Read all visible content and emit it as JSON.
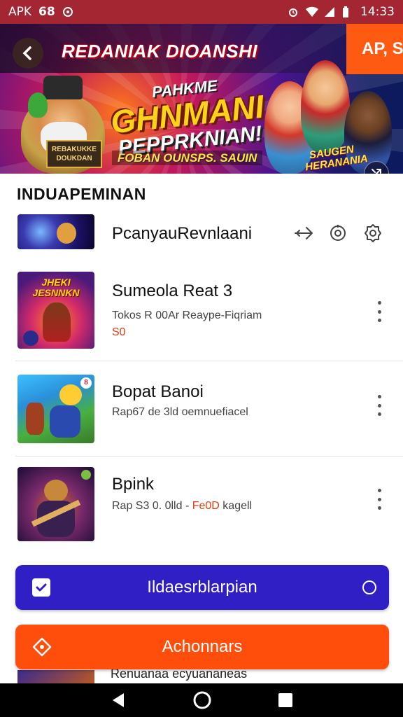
{
  "status_bar": {
    "left_text": "APK",
    "left_text_2": "68",
    "time": "14:33",
    "icons": [
      "app-icon",
      "alarm-icon",
      "wifi-icon",
      "signal-icon",
      "battery-icon"
    ]
  },
  "banner": {
    "title": "REDANIAK DIOANSHI",
    "corner_label": "AP, Se",
    "headline_1": "PAHKME",
    "headline_2": "GHNMANI",
    "headline_3": "PEPPRKNIAN!",
    "tagline": "FOBAN OUNSPS. SAUIN",
    "plaque": "REBAKUKKE DOUKDAN",
    "badge": "SAUGEN HERANANIA",
    "colors": {
      "corner": "#ff5a12",
      "headline": "#ffd21a"
    }
  },
  "section": {
    "title": "INDUAPEMINAN"
  },
  "list": [
    {
      "title": "PcanyauRevnlaani",
      "subtitle": "",
      "subtitle_accent": "",
      "extra": "",
      "thumb_icon": "game-thumbnail"
    },
    {
      "title": "Sumeola Reat 3",
      "subtitle": "Tokos R 00Ar Reaype-Fiqriam",
      "subtitle_accent": "",
      "extra": "S0",
      "thumb_icon": "game-thumbnail",
      "thumb_text": "JHEKI JESNNKN"
    },
    {
      "title": "Bopat Banoi",
      "subtitle": "Rap67 de 3ld oemnuefiacel",
      "subtitle_accent": "",
      "extra": "",
      "thumb_icon": "game-thumbnail",
      "thumb_badge": "8"
    },
    {
      "title": "Bpink",
      "subtitle": "Rap S3 0. 0lld -",
      "subtitle_accent": "Fe0D",
      "subtitle_tail": " kagell",
      "extra": "",
      "thumb_icon": "game-thumbnail"
    }
  ],
  "row_actions": [
    "airplane-icon",
    "target-icon",
    "settings-icon"
  ],
  "buttons": {
    "primary_label": "Ildaesrblarpian",
    "primary_color": "#2f1fc4",
    "secondary_label": "Achonnars",
    "secondary_color": "#ff4d0c"
  },
  "peek_text": "Renuanaa ecyuananeas",
  "nav": [
    "back-icon",
    "home-icon",
    "recents-icon"
  ]
}
